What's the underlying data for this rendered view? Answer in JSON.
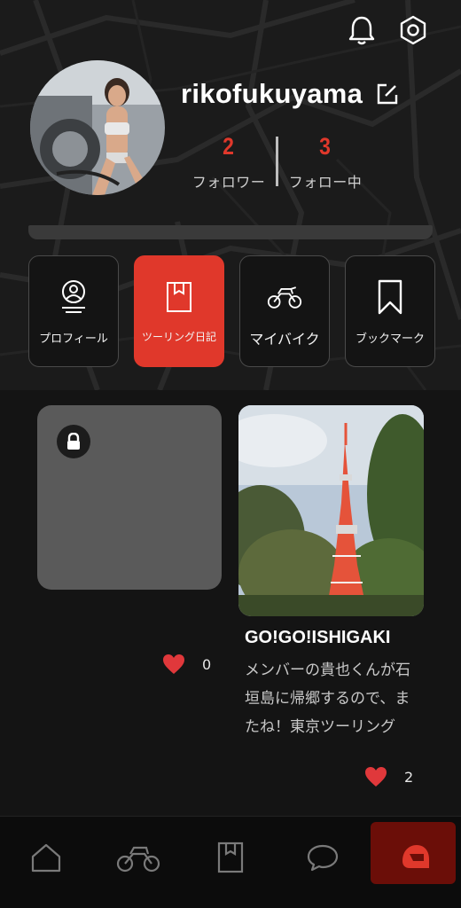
{
  "colors": {
    "accent": "#e0382b",
    "background": "#141414",
    "nav_selected": "#6b0e08"
  },
  "header": {
    "icons": [
      "bell-icon",
      "settings-icon"
    ],
    "avatar_alt": "avatar"
  },
  "profile": {
    "username": "rikofukuyama",
    "edit_icon": "edit-icon",
    "followers_count": "2",
    "followers_label": "フォロワー",
    "following_count": "3",
    "following_label": "フォロー中"
  },
  "tabs": [
    {
      "label": "プロフィール",
      "icon": "profile-icon",
      "active": false
    },
    {
      "label": "ツーリング日記",
      "icon": "diary-book-icon",
      "active": true
    },
    {
      "label": "マイバイク",
      "icon": "motorcycle-icon",
      "active": false
    },
    {
      "label": "ブックマーク",
      "icon": "bookmark-icon",
      "active": false
    }
  ],
  "posts": [
    {
      "private": true,
      "icon": "lock-icon",
      "likes": "0"
    },
    {
      "private": false,
      "title": "GO!GO!ISHIGAKI",
      "body": "メンバーの貴也くんが石垣島に帰郷するので、またね！東京ツーリング",
      "likes": "2"
    }
  ],
  "bottom_nav": [
    {
      "icon": "home-icon",
      "selected": false
    },
    {
      "icon": "motorcycle-icon",
      "selected": false
    },
    {
      "icon": "diary-book-icon",
      "selected": false
    },
    {
      "icon": "chat-icon",
      "selected": false
    },
    {
      "icon": "helmet-icon",
      "selected": true
    }
  ]
}
